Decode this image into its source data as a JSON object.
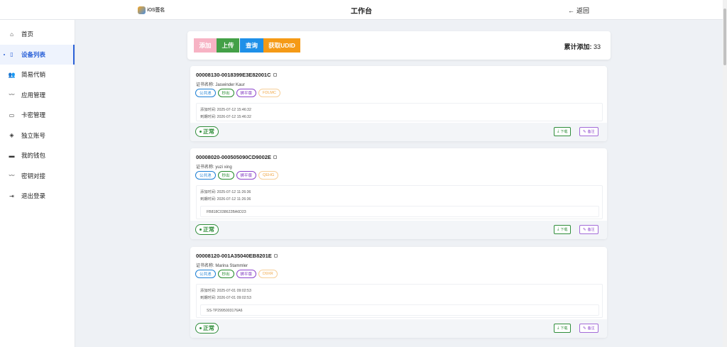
{
  "app": {
    "logo_text": "iOS签名",
    "title": "工作台",
    "back_label": "返回"
  },
  "sidebar": {
    "items": [
      {
        "label": "首页",
        "icon": "home-icon",
        "active": false
      },
      {
        "label": "设备列表",
        "icon": "phone-icon",
        "active": true
      },
      {
        "label": "简易代销",
        "icon": "users-icon",
        "active": false
      },
      {
        "label": "应用管理",
        "icon": "chart-line-icon",
        "active": false
      },
      {
        "label": "卡密管理",
        "icon": "card-icon",
        "active": false
      },
      {
        "label": "独立账号",
        "icon": "layers-icon",
        "active": false
      },
      {
        "label": "我的钱包",
        "icon": "wallet-icon",
        "active": false
      },
      {
        "label": "密钥对接",
        "icon": "key-link-icon",
        "active": false
      },
      {
        "label": "退出登录",
        "icon": "logout-icon",
        "active": false
      }
    ]
  },
  "toolbar": {
    "add_label": "添加",
    "upload_label": "上传",
    "query_label": "查询",
    "udid_label": "获取UDID",
    "count_label": "累计添加:",
    "count_value": "33",
    "colors": {
      "add": "#f7b3c4",
      "upload": "#43a047",
      "query": "#1e90e8",
      "udid": "#f59a16"
    }
  },
  "cards": [
    {
      "id": "00008130-0018399E3E82001C",
      "cert_label": "证书名称:",
      "cert_name": "Jaswinder Kaur",
      "tags": [
        "公共池",
        "秒出",
        "狮平版",
        "FDLMC"
      ],
      "added_label": "添加时间:",
      "added": "2025-07-12 15:46:32",
      "expire_label": "到期时间:",
      "expire": "2026-07-12 15:46:32",
      "udid_note": "",
      "status": "正常",
      "download_label": "下载",
      "note_label": "备注"
    },
    {
      "id": "00008020-000505090CD9002E",
      "cert_label": "证书名称:",
      "cert_name": "yuzi xing",
      "tags": [
        "公共池",
        "秒出",
        "狮平版",
        "QEHG"
      ],
      "added_label": "添加时间:",
      "added": "2025-07-12 11:26:36",
      "expire_label": "到期时间:",
      "expire": "2026-07-12 11:26:36",
      "udid_note": "FB818C038622BA6D23",
      "status": "正常",
      "download_label": "下载",
      "note_label": "备注"
    },
    {
      "id": "00008120-001A35040EB8201E",
      "cert_label": "证书名称:",
      "cert_name": "Marina Stammler",
      "tags": [
        "公共池",
        "秒出",
        "狮平版",
        "D9XR"
      ],
      "added_label": "添加时间:",
      "added": "2025-07-01 09:02:53",
      "expire_label": "到期时间:",
      "expire": "2026-07-01 09:02:53",
      "udid_note": "SS-TP2995003176A6",
      "status": "正常",
      "download_label": "下载",
      "note_label": "备注"
    }
  ]
}
